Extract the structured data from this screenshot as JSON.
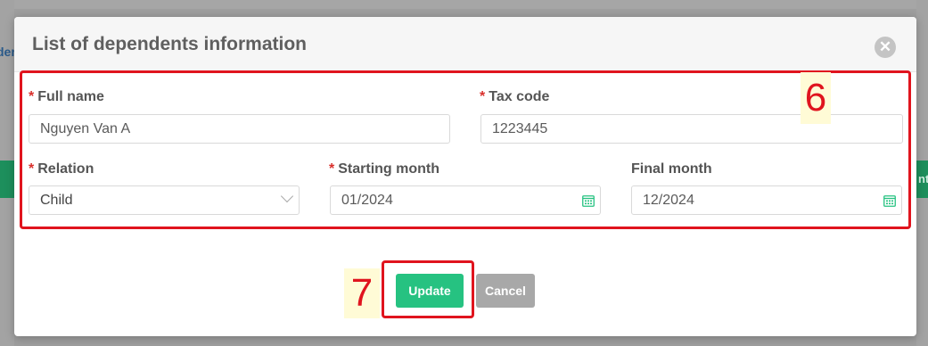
{
  "background": {
    "left_link_text": "der",
    "right_button_text": "nt"
  },
  "modal": {
    "title": "List of dependents information",
    "close_icon": "close-icon",
    "required_mark": "*"
  },
  "fields": {
    "full_name": {
      "label": "Full name",
      "value": "Nguyen Van A",
      "required": true
    },
    "tax_code": {
      "label": "Tax code",
      "value": "1223445",
      "required": true
    },
    "relation": {
      "label": "Relation",
      "value": "Child",
      "required": true
    },
    "starting_month": {
      "label": "Starting month",
      "value": "01/2024",
      "required": true
    },
    "final_month": {
      "label": "Final month",
      "value": "12/2024",
      "required": false
    }
  },
  "buttons": {
    "update": "Update",
    "cancel": "Cancel"
  },
  "annotations": {
    "form_step": "6",
    "button_step": "7"
  },
  "colors": {
    "primary": "#26c281",
    "required": "#d9302c",
    "annotation": "#e0141e",
    "cancel": "#a8a8a8"
  }
}
